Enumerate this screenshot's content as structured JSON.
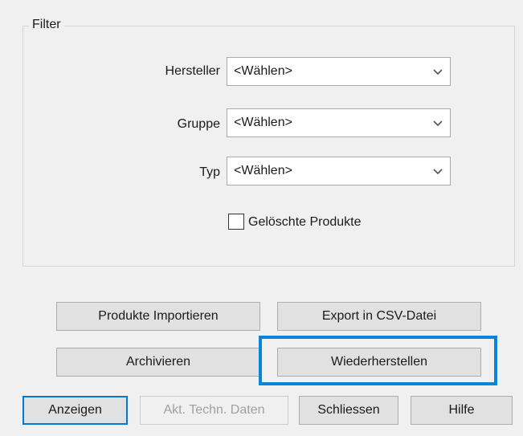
{
  "filter": {
    "legend": "Filter",
    "hersteller": {
      "label": "Hersteller",
      "value": "<Wählen>"
    },
    "gruppe": {
      "label": "Gruppe",
      "value": "<Wählen>"
    },
    "typ": {
      "label": "Typ",
      "value": "<Wählen>"
    },
    "geloeschte": {
      "label": "Gelöschte Produkte",
      "checked": false
    }
  },
  "buttons": {
    "import": "Produkte Importieren",
    "export": "Export in CSV-Datei",
    "archive": "Archivieren",
    "restore": "Wiederherstellen",
    "show": "Anzeigen",
    "tech_data": "Akt. Techn. Daten",
    "close": "Schliessen",
    "help": "Hilfe"
  },
  "colors": {
    "highlight": "#0a84d9",
    "default_button_border": "#0078d7"
  }
}
